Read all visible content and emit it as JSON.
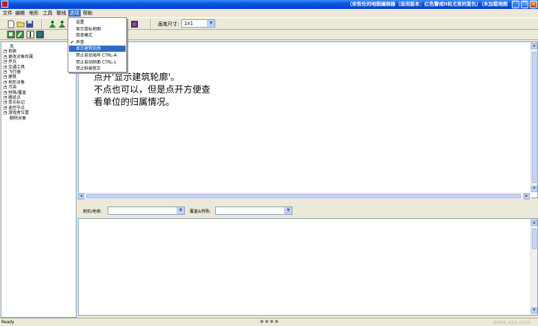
{
  "window": {
    "title": "（宋哲伦的地图编辑器（适用版本：红色警戒II和尤里的复仇）（未加载地图",
    "min_icon": "minimize-icon",
    "max_icon": "maximize-icon",
    "close_icon": "close-icon",
    "min_label": "_",
    "max_label": "❐",
    "close_label": "×"
  },
  "menubar": {
    "items": [
      "文件",
      "编辑",
      "地形",
      "工具",
      "联线",
      "选项",
      "帮助"
    ]
  },
  "options_menu": {
    "items": [
      {
        "label": "设置",
        "checked": false
      },
      {
        "label": "显示鼠标地图",
        "checked": false
      },
      {
        "label": "简单模式",
        "checked": false
      },
      {
        "label": "声音",
        "checked": true
      },
      {
        "label": "显示建筑轮廓",
        "checked": false,
        "highlighted": true
      },
      {
        "label": "禁止自动海岸  CTRL-A",
        "checked": false
      },
      {
        "label": "禁止自动斜面  CTRL-L",
        "checked": false
      },
      {
        "label": "禁止斜坡修正",
        "checked": false
      }
    ],
    "check_mark": "✔"
  },
  "toolbar": {
    "pen_size_label": "画笔尺寸:",
    "pen_size_value": "1x1"
  },
  "tree": {
    "items": [
      {
        "label": "无",
        "expandable": false
      },
      {
        "label": "地表",
        "expandable": true
      },
      {
        "label": "更改对象所属",
        "expandable": true
      },
      {
        "label": "步兵",
        "expandable": true
      },
      {
        "label": "交通工具",
        "expandable": true
      },
      {
        "label": "飞行器",
        "expandable": true
      },
      {
        "label": "建筑",
        "expandable": true
      },
      {
        "label": "地形对象",
        "expandable": true
      },
      {
        "label": "污染",
        "expandable": true
      },
      {
        "label": "特殊/覆盖",
        "expandable": true
      },
      {
        "label": "路径点",
        "expandable": true
      },
      {
        "label": "单元标记",
        "expandable": true
      },
      {
        "label": "遥控节点",
        "expandable": true
      },
      {
        "label": "游戏者位置",
        "expandable": true
      },
      {
        "label": "删除对象",
        "expandable": false
      }
    ],
    "expand_glyph": "+"
  },
  "canvas": {
    "note_lines": [
      "点开'显示建筑轮廓'。",
      "不点也可以，但是点开方便查",
      "看单位的归属情况。"
    ]
  },
  "bottom_panel": {
    "terrain_label": "地形/地表:",
    "overlay_label": "覆盖&特殊:",
    "terrain_value": "",
    "overlay_value": ""
  },
  "statusbar": {
    "text": "Ready",
    "pager": "● ● ● ●",
    "watermark": "www.xxx.com"
  },
  "scroll": {
    "up": "▲",
    "down": "▼",
    "left": "◀",
    "right": "▶",
    "combo_arrow": "▼"
  },
  "colors": {
    "titlebar": "#0a54e3",
    "highlight": "#316ac5"
  }
}
